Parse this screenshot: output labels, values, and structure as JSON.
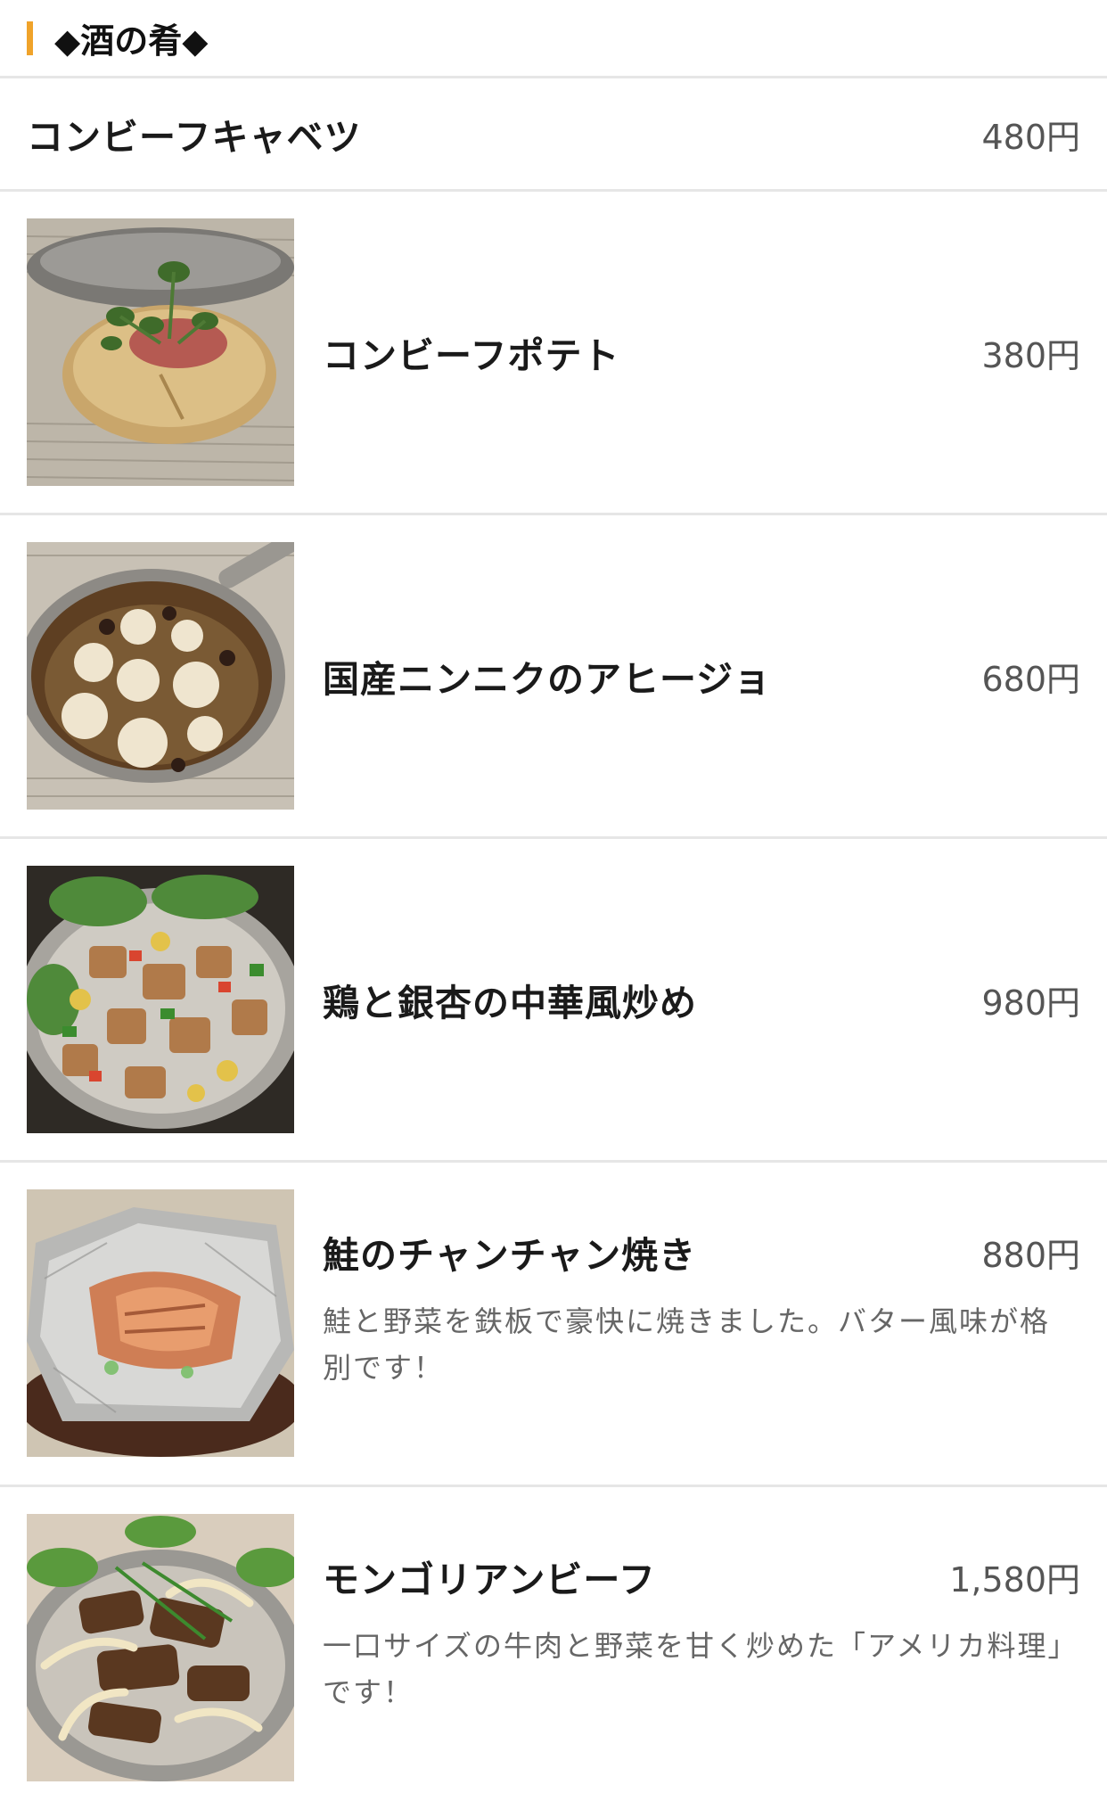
{
  "section": {
    "title": "◆酒の肴◆",
    "accent_color": "#f0a32a"
  },
  "items": [
    {
      "name": "コンビーフキャベツ",
      "price": "480円",
      "has_image": false
    },
    {
      "name": "コンビーフポテト",
      "price": "380円",
      "has_image": true,
      "image_icon": "baked-potato-photo"
    },
    {
      "name": "国産ニンニクのアヒージョ",
      "price": "680円",
      "has_image": true,
      "image_icon": "garlic-ajillo-photo"
    },
    {
      "name": "鶏と銀杏の中華風炒め",
      "price": "980円",
      "has_image": true,
      "image_icon": "chicken-ginkgo-stirfry-photo"
    },
    {
      "name": "鮭のチャンチャン焼き",
      "price": "880円",
      "description": "鮭と野菜を鉄板で豪快に焼きました。バター風味が格別です！",
      "has_image": true,
      "image_icon": "salmon-foil-photo"
    },
    {
      "name": "モンゴリアンビーフ",
      "price": "1,580円",
      "description": "一口サイズの牛肉と野菜を甘く炒めた「アメリカ料理」です！",
      "has_image": true,
      "image_icon": "mongolian-beef-photo"
    }
  ]
}
